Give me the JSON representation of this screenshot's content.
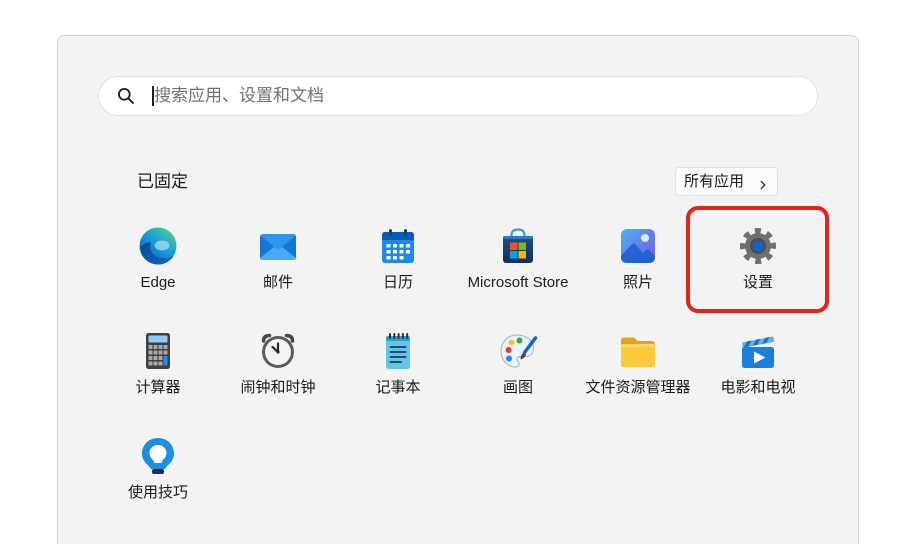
{
  "search": {
    "placeholder": "搜索应用、设置和文档",
    "icon": "search-icon"
  },
  "pinned": {
    "title": "已固定",
    "all_apps": {
      "label": "所有应用",
      "icon": "chevron-right-icon"
    },
    "apps": [
      {
        "label": "Edge",
        "icon": "edge-icon",
        "highlighted": false
      },
      {
        "label": "邮件",
        "icon": "mail-icon",
        "highlighted": false
      },
      {
        "label": "日历",
        "icon": "calendar-icon",
        "highlighted": false
      },
      {
        "label": "Microsoft Store",
        "icon": "store-icon",
        "highlighted": false
      },
      {
        "label": "照片",
        "icon": "photos-icon",
        "highlighted": false
      },
      {
        "label": "设置",
        "icon": "gear-icon",
        "highlighted": true
      },
      {
        "label": "计算器",
        "icon": "calculator-icon",
        "highlighted": false
      },
      {
        "label": "闹钟和时钟",
        "icon": "alarm-clock-icon",
        "highlighted": false
      },
      {
        "label": "记事本",
        "icon": "notepad-icon",
        "highlighted": false
      },
      {
        "label": "画图",
        "icon": "paint-palette-icon",
        "highlighted": false
      },
      {
        "label": "文件资源管理器",
        "icon": "folder-icon",
        "highlighted": false
      },
      {
        "label": "电影和电视",
        "icon": "movies-tv-icon",
        "highlighted": false
      },
      {
        "label": "使用技巧",
        "icon": "lightbulb-icon",
        "highlighted": false
      }
    ]
  },
  "theme": {
    "page-bg": "#ffffff",
    "panel-bg": "#f3f3f3",
    "panel-border": "#d4d4d4",
    "search-border": "#e2e2e2",
    "text": "#1b1b1b",
    "placeholder": "#717171",
    "highlight": "#e6231b"
  }
}
